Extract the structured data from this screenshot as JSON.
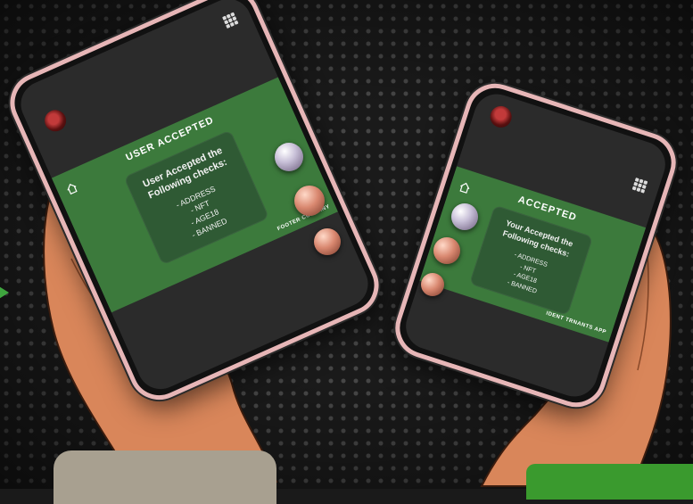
{
  "left_phone": {
    "title": "USER ACCEPTED",
    "card_heading": "User Accepted the Following checks:",
    "checks": [
      "- ADDRESS",
      "- NFT",
      "- AGE18",
      "- BANNED"
    ],
    "footer": "FOOTER COMPANY"
  },
  "right_phone": {
    "title": "ACCEPTED",
    "card_heading": "Your Accepted the Following checks:",
    "checks": [
      "- ADDRESS",
      "- NFT",
      "- AGE18",
      "- BANNED"
    ],
    "footer": "IDENT TRNANTS APP"
  },
  "colors": {
    "screen_green": "#3c7a3c",
    "card_green": "#2f5a34",
    "phone_frame": "#e7b6b7",
    "background": "#1a1a1a"
  },
  "icons": [
    "home-icon",
    "grid-menu-icon",
    "logo-emblem"
  ]
}
